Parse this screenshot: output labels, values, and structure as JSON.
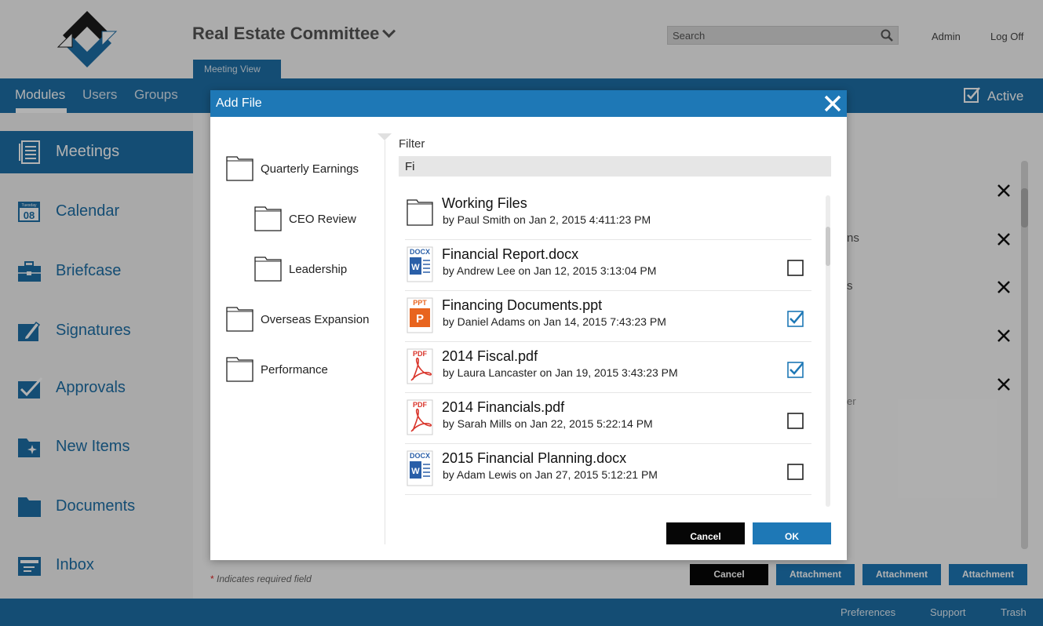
{
  "header": {
    "committee_title": "Real Estate Committee",
    "search_placeholder": "Search",
    "admin_label": "Admin",
    "logoff_label": "Log Off",
    "meeting_tab_label": "Meeting View"
  },
  "nav": {
    "items": [
      "Modules",
      "Users",
      "Groups"
    ],
    "active_label": "Active"
  },
  "sidebar": {
    "items": [
      {
        "label": "Meetings",
        "icon": "meetings-icon"
      },
      {
        "label": "Calendar",
        "icon": "calendar-icon",
        "icon_text_top": "Tuesday",
        "icon_text_day": "08"
      },
      {
        "label": "Briefcase",
        "icon": "briefcase-icon"
      },
      {
        "label": "Signatures",
        "icon": "signature-icon"
      },
      {
        "label": "Approvals",
        "icon": "approvals-icon"
      },
      {
        "label": "New Items",
        "icon": "new-items-icon"
      },
      {
        "label": "Documents",
        "icon": "documents-icon"
      },
      {
        "label": "Inbox",
        "icon": "inbox-icon"
      }
    ]
  },
  "background": {
    "fragments": [
      "ns",
      "s",
      "er"
    ],
    "required_note": "Indicates required field",
    "required_star": "*",
    "buttons": {
      "cancel": "Cancel",
      "attachment": "Attachment"
    }
  },
  "footer": {
    "preferences": "Preferences",
    "support": "Support",
    "trash": "Trash"
  },
  "modal": {
    "title": "Add File",
    "folders": [
      {
        "label": "Quarterly Earnings",
        "level": 0
      },
      {
        "label": "CEO Review",
        "level": 1
      },
      {
        "label": "Leadership",
        "level": 1
      },
      {
        "label": "Overseas Expansion",
        "level": 0
      },
      {
        "label": "Performance",
        "level": 0
      }
    ],
    "filter_label": "Filter",
    "filter_value": "Fi",
    "files": [
      {
        "type": "folder",
        "badge": "",
        "name": "Working Files",
        "meta": "by Paul Smith on Jan 2, 2015 4:411:23 PM",
        "checked": null
      },
      {
        "type": "docx",
        "badge": "DOCX",
        "name": "Financial Report.docx",
        "meta": "by Andrew Lee on Jan 12, 2015 3:13:04 PM",
        "checked": false
      },
      {
        "type": "ppt",
        "badge": "PPT",
        "name": "Financing Documents.ppt",
        "meta": "by Daniel Adams on Jan 14, 2015 7:43:23 PM",
        "checked": true
      },
      {
        "type": "pdf",
        "badge": "PDF",
        "name": "2014 Fiscal.pdf",
        "meta": "by Laura Lancaster on Jan 19, 2015 3:43:23 PM",
        "checked": true
      },
      {
        "type": "pdf",
        "badge": "PDF",
        "name": "2014 Financials.pdf",
        "meta": "by Sarah Mills on Jan 22, 2015 5:22:14 PM",
        "checked": false
      },
      {
        "type": "docx",
        "badge": "DOCX",
        "name": "2015 Financial Planning.docx",
        "meta": "by Adam Lewis on Jan 27, 2015 5:12:21 PM",
        "checked": false
      }
    ],
    "cancel_label": "Cancel",
    "ok_label": "OK"
  },
  "colors": {
    "brand_blue": "#1e6fa6",
    "modal_blue": "#1e78b6",
    "ppt_orange": "#e8641e",
    "pdf_red": "#d9352b",
    "docx_blue": "#2a5fa8"
  }
}
